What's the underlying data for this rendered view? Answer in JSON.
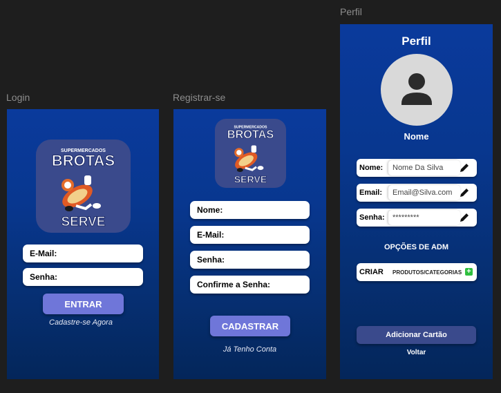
{
  "frames": {
    "login": {
      "label": "Login"
    },
    "register": {
      "label": "Registrar-se"
    },
    "profile": {
      "label": "Perfil"
    }
  },
  "logo": {
    "top_text": "SUPERMERCADOS",
    "brand": "BROTAS",
    "bottom": "SERVE"
  },
  "login": {
    "email_label": "E-Mail:",
    "password_label": "Senha:",
    "enter_button": "ENTRAR",
    "signup_link": "Cadastre-se Agora"
  },
  "register": {
    "name_label": "Nome:",
    "email_label": "E-Mail:",
    "password_label": "Senha:",
    "confirm_label": "Confirme a Senha:",
    "submit_button": "CADASTRAR",
    "have_account_link": "Já Tenho Conta"
  },
  "profile": {
    "title": "Perfil",
    "name": "Nome",
    "fields": [
      {
        "label": "Nome:",
        "value": "Nome Da Silva"
      },
      {
        "label": "Email:",
        "value": "Email@Silva.com"
      },
      {
        "label": "Senha:",
        "value": "*********"
      }
    ],
    "admin_heading": "OPÇÕES DE ADM",
    "create_label": "CRIAR",
    "create_value": "PRODUTOS/CATEGORIAS",
    "add_card_button": "Adicionar Cartão",
    "back_link": "Voltar"
  },
  "colors": {
    "background": "#1e1e1e",
    "frame_top": "#0a3a9c",
    "frame_bottom": "#04265a",
    "primary_button": "#6f76d9",
    "secondary_button": "#3a4a8c",
    "plus_green": "#2fbf3f"
  },
  "icons": [
    "avatar-person-icon",
    "pencil-edit-icon",
    "plus-icon"
  ]
}
